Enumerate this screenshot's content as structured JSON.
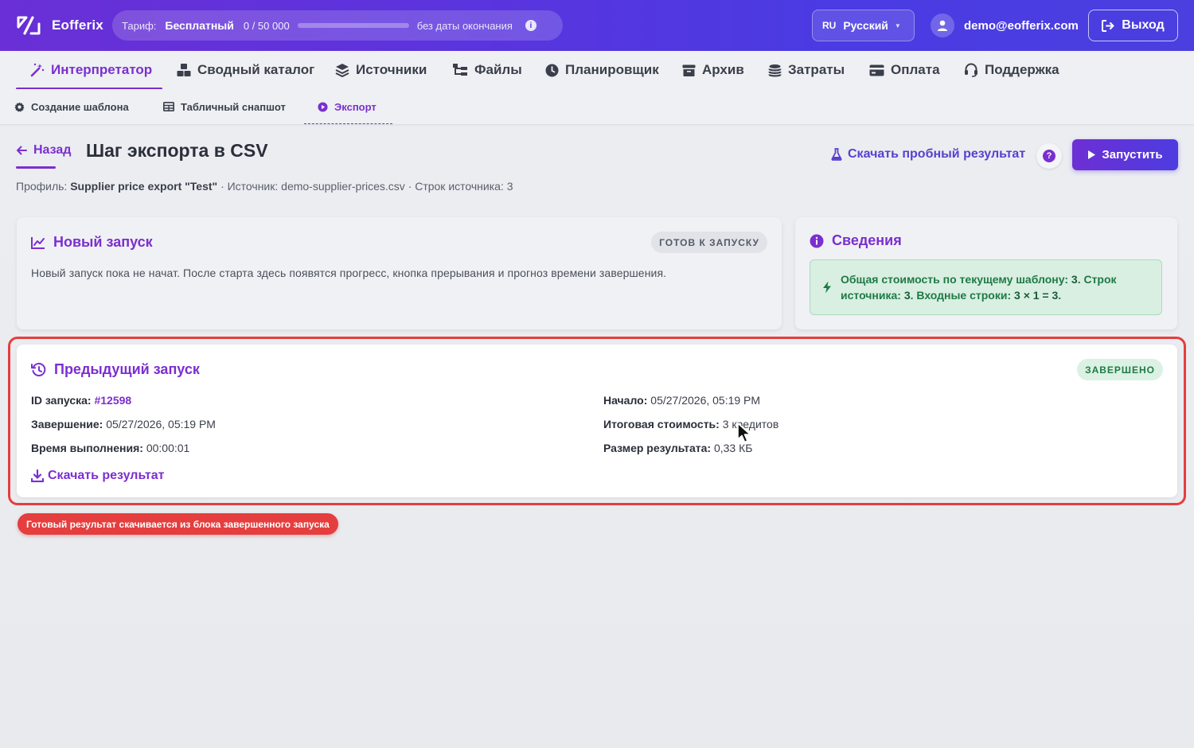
{
  "app": {
    "name": "Eofferix"
  },
  "plan": {
    "label": "Тариф:",
    "name": "Бесплатный",
    "usage": "0 / 50 000",
    "usage_fraction": 0,
    "expiry": "без даты окончания",
    "info_icon": "info-icon"
  },
  "language": {
    "code": "RU",
    "name": "Русский"
  },
  "user": {
    "email": "demo@eofferix.com"
  },
  "logout_label": "Выход",
  "main_nav": [
    {
      "label": "Интерпретатор",
      "icon": "magic-wand-icon",
      "active": true
    },
    {
      "label": "Сводный каталог",
      "icon": "boxes-icon",
      "active": false
    },
    {
      "label": "Источники",
      "icon": "layers-icon",
      "active": false
    },
    {
      "label": "Файлы",
      "icon": "file-tree-icon",
      "active": false
    },
    {
      "label": "Планировщик",
      "icon": "clock-icon",
      "active": false
    },
    {
      "label": "Архив",
      "icon": "archive-icon",
      "active": false
    },
    {
      "label": "Затраты",
      "icon": "coins-icon",
      "active": false
    },
    {
      "label": "Оплата",
      "icon": "credit-card-icon",
      "active": false
    },
    {
      "label": "Поддержка",
      "icon": "headset-icon",
      "active": false
    }
  ],
  "sub_nav": [
    {
      "label": "Создание шаблона",
      "icon": "gear-icon",
      "active": false
    },
    {
      "label": "Табличный снапшот",
      "icon": "table-icon",
      "active": false
    },
    {
      "label": "Экспорт",
      "icon": "play-circle-icon",
      "active": true
    }
  ],
  "page": {
    "back_label": "Назад",
    "title": "Шаг экспорта в CSV",
    "meta_profile_label": "Профиль:",
    "meta_profile_value": "Supplier price export \"Test\"",
    "meta_rest": "· Источник: demo-supplier-prices.csv · Строк источника: 3",
    "download_sample_label": "Скачать пробный результат",
    "help_label": "?",
    "run_label": "Запустить"
  },
  "new_run": {
    "title": "Новый запуск",
    "badge": "ГОТОВ К ЗАПУСКУ",
    "description": "Новый запуск пока не начат. После старта здесь появятся прогресс, кнопка прерывания и прогноз времени завершения."
  },
  "details": {
    "title": "Сведения",
    "line1_a": "Общая стоимость по текущему шаблону: ",
    "line1_b": "3",
    "line1_c": ". Строк",
    "line2_a": "источника: ",
    "line2_b": "3",
    "line2_c": ". Входные строки: ",
    "line2_d": "3 × 1 = 3",
    "line2_e": "."
  },
  "previous_run": {
    "title": "Предыдущий запуск",
    "badge": "ЗАВЕРШЕНО",
    "id_label": "ID запуска:",
    "id_value": "#12598",
    "end_label": "Завершение:",
    "end_value": "05/27/2026, 05:19 PM",
    "duration_label": "Время выполнения:",
    "duration_value": "00:00:01",
    "start_label": "Начало:",
    "start_value": "05/27/2026, 05:19 PM",
    "cost_label": "Итоговая стоимость:",
    "cost_value": "3 кредитов",
    "size_label": "Размер результата:",
    "size_value": "0,33 КБ",
    "download_label": "Скачать результат"
  },
  "tooltip": "Готовый результат скачивается из блока завершенного запуска",
  "colors": {
    "accent": "#7b2fcf",
    "highlight": "#e53e3e",
    "success": "#1f7a45"
  }
}
